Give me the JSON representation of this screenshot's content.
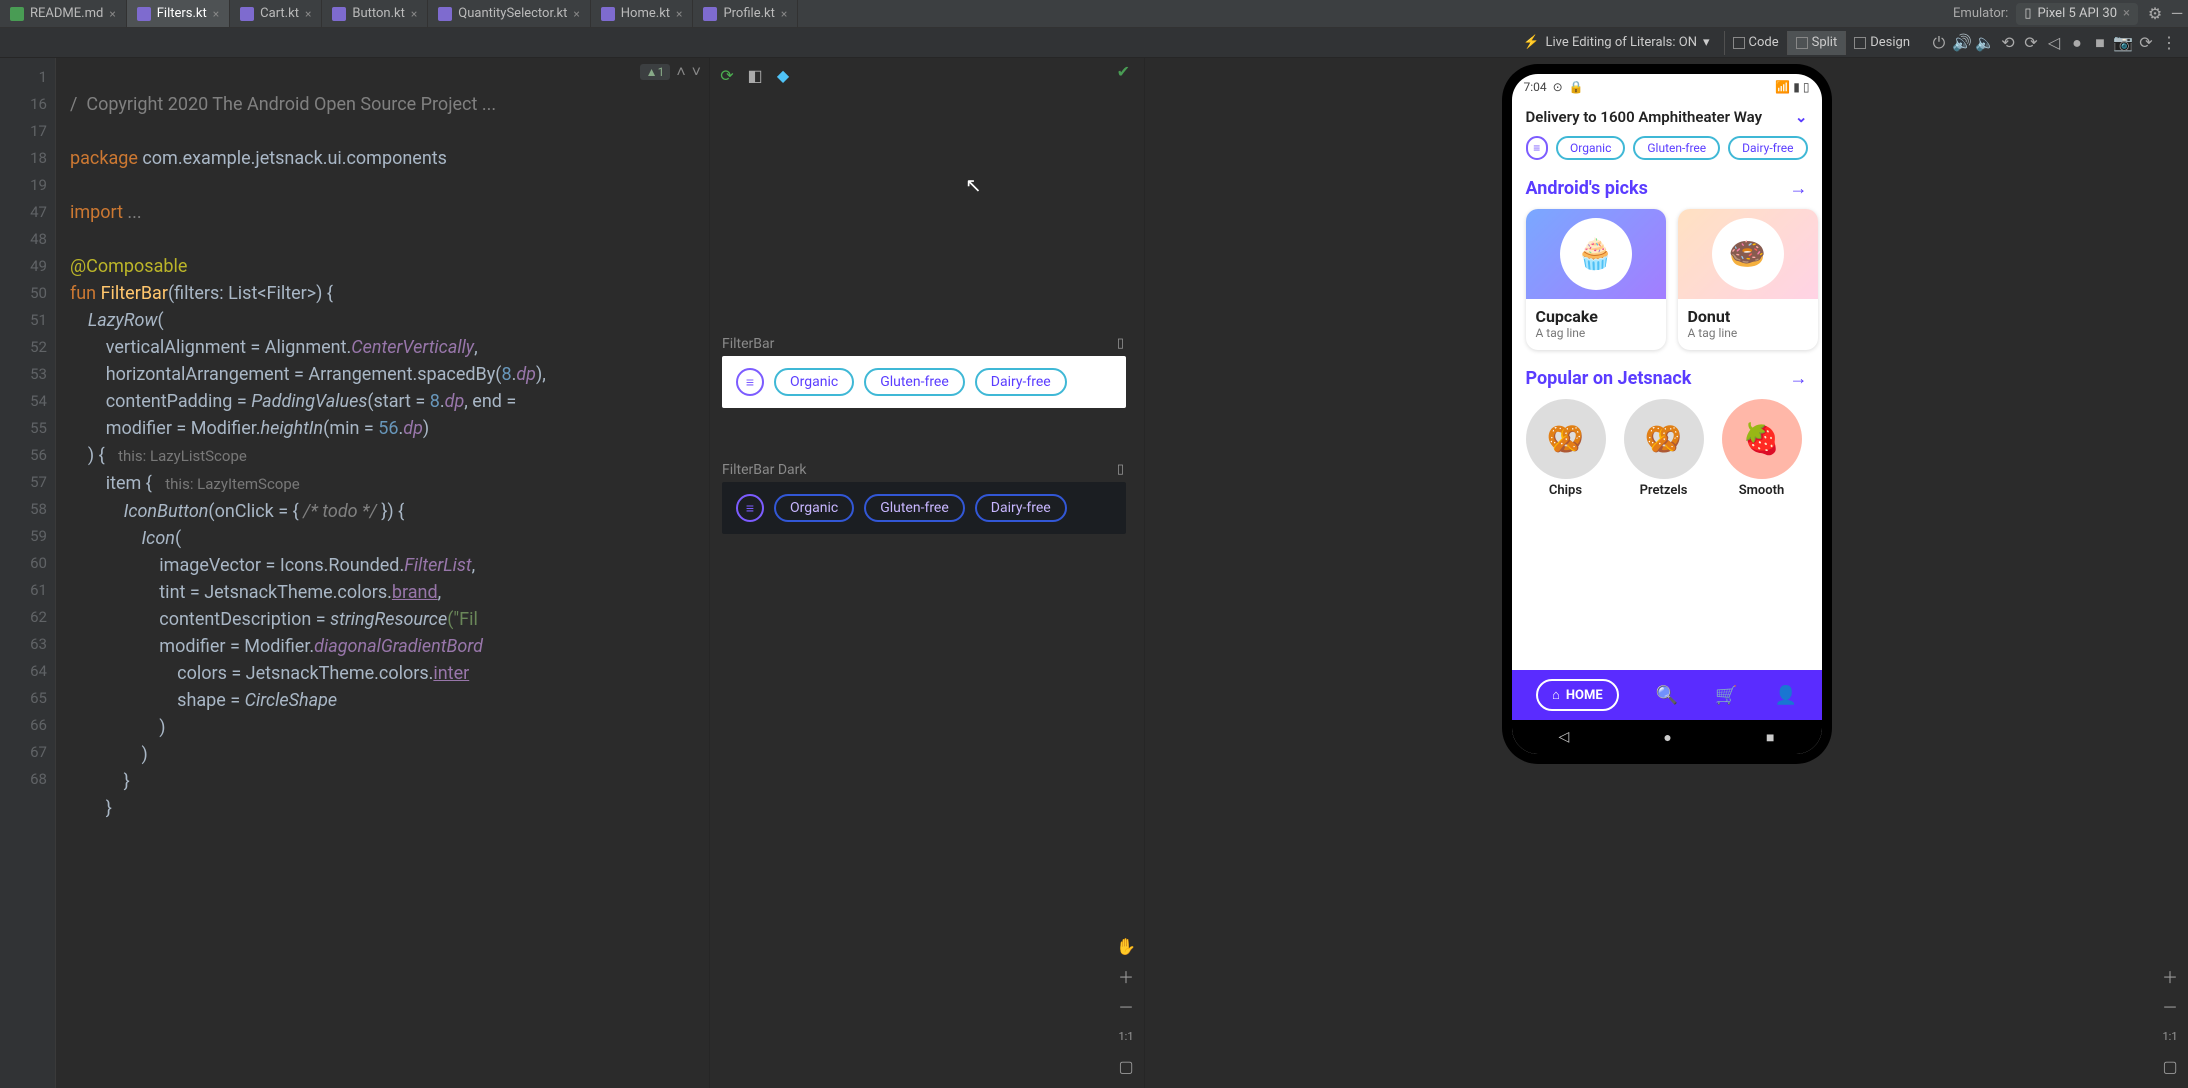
{
  "tabs": [
    {
      "name": "README.md",
      "icon": "md",
      "active": false
    },
    {
      "name": "Filters.kt",
      "icon": "kt",
      "active": true
    },
    {
      "name": "Cart.kt",
      "icon": "kt",
      "active": false
    },
    {
      "name": "Button.kt",
      "icon": "kt",
      "active": false
    },
    {
      "name": "QuantitySelector.kt",
      "icon": "kt",
      "active": false
    },
    {
      "name": "Home.kt",
      "icon": "kt",
      "active": false
    },
    {
      "name": "Profile.kt",
      "icon": "kt",
      "active": false
    }
  ],
  "emulator_label": "Emulator:",
  "device_name": "Pixel 5 API 30",
  "live_edit": "Live Editing of Literals: ON",
  "view_modes": {
    "code": "Code",
    "split": "Split",
    "design": "Design"
  },
  "gutter": [
    "1",
    "16",
    "17",
    "18",
    "19",
    "47",
    "48",
    "49",
    "50",
    "51",
    "52",
    "53",
    "54",
    "55",
    "56",
    "57",
    "58",
    "59",
    "60",
    "61",
    "62",
    "63",
    "64",
    "65",
    "66",
    "67",
    "68"
  ],
  "code": {
    "l0_cm": "/  Copyright 2020 The Android Open Source Project ...",
    "l2a": "package",
    "l2b": " com.example.jetsnack.ui.components",
    "l4a": "import",
    "l4b": " ...",
    "l6": "@Composable",
    "l7a": "fun ",
    "l7b": "FilterBar",
    "l7c": "(filters: List<Filter>) {",
    "l8a": "    ",
    "l8b": "LazyRow",
    "l8c": "(",
    "l9a": "        verticalAlignment = Alignment.",
    "l9b": "CenterVertically",
    "l9c": ",",
    "l10a": "        horizontalArrangement = Arrangement.spacedBy(",
    "l10b": "8",
    "l10c": ".",
    "l10d": "dp",
    "l10e": "),",
    "l11a": "        contentPadding = ",
    "l11b": "PaddingValues",
    "l11c": "(start = ",
    "l11d": "8",
    "l11e": ".",
    "l11f": "dp",
    "l11g": ", end = ",
    "l12a": "        modifier = Modifier.",
    "l12b": "heightIn",
    "l12c": "(min = ",
    "l12d": "56",
    "l12e": ".",
    "l12f": "dp",
    "l12g": ")",
    "l13a": "    ) {   ",
    "l13h": "this: LazyListScope",
    "l14a": "        item {   ",
    "l14h": "this: LazyItemScope",
    "l15a": "            ",
    "l15b": "IconButton",
    "l15c": "(onClick = { ",
    "l15cm": "/* todo */",
    "l15d": " }) {",
    "l16a": "                ",
    "l16b": "Icon",
    "l16c": "(",
    "l17a": "                    imageVector = Icons.Rounded.",
    "l17b": "FilterList",
    "l17c": ",",
    "l18a": "                    tint = JetsnackTheme.colors.",
    "l18b": "brand",
    "l18c": ",",
    "l19a": "                    contentDescription = ",
    "l19b": "stringResource",
    "l19c": "(\"Fil",
    "l20a": "                    modifier = Modifier.",
    "l20b": "diagonalGradientBord",
    "l21a": "                        colors = JetsnackTheme.colors.",
    "l21b": "inter",
    "l22a": "                        shape = ",
    "l22b": "CircleShape",
    "l23": "                    )",
    "l24": "                )",
    "l25": "            }",
    "l26": "        }"
  },
  "problems_badge": "1",
  "preview": {
    "label_light": "FilterBar",
    "label_dark": "FilterBar Dark",
    "chips": [
      "Organic",
      "Gluten-free",
      "Dairy-free"
    ],
    "zoom_label": "1:1"
  },
  "phone": {
    "time": "7:04",
    "delivery": "Delivery to 1600 Amphitheater Way",
    "chips": [
      "Organic",
      "Gluten-free",
      "Dairy-free"
    ],
    "section1": "Android's picks",
    "cards": [
      {
        "name": "Cupcake",
        "tag": "A tag line",
        "emoji": "🧁"
      },
      {
        "name": "Donut",
        "tag": "A tag line",
        "emoji": "🍩"
      }
    ],
    "section2": "Popular on Jetsnack",
    "circles": [
      {
        "label": "Chips",
        "emoji": "🥨"
      },
      {
        "label": "Pretzels",
        "emoji": "🥨"
      },
      {
        "label": "Smooth",
        "emoji": "🍓"
      }
    ],
    "nav_home": "HOME"
  },
  "emu_zoom": "1:1"
}
